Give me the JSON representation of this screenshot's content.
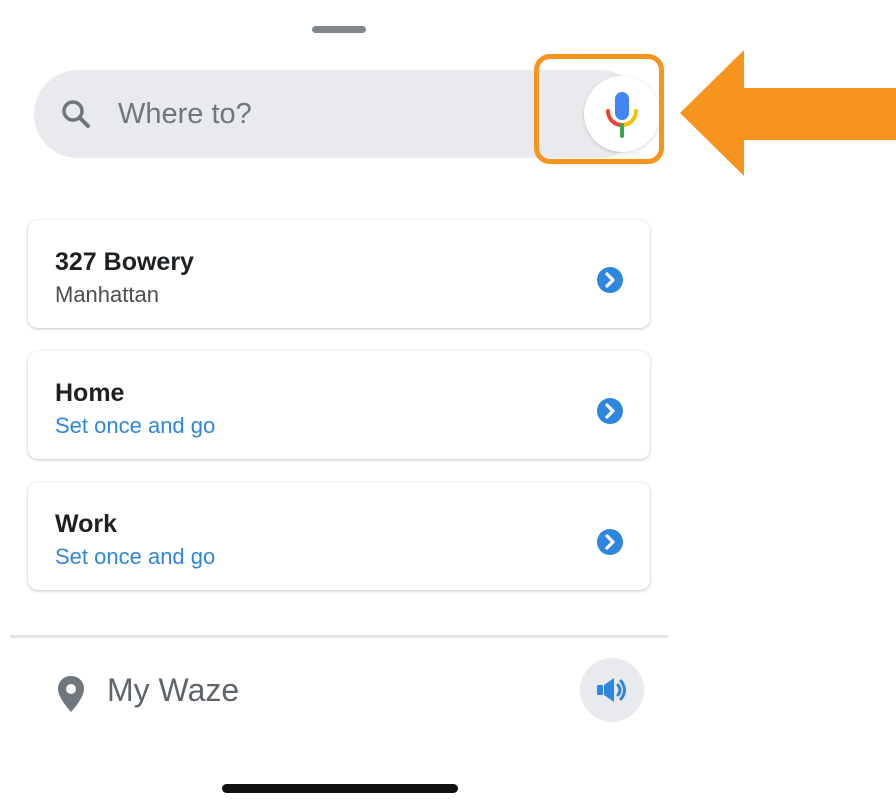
{
  "search": {
    "placeholder": "Where to?"
  },
  "destinations": [
    {
      "title": "327 Bowery",
      "subtitle": "Manhattan"
    },
    {
      "title": "Home",
      "subtitle": "Set once and go"
    },
    {
      "title": "Work",
      "subtitle": "Set once and go"
    }
  ],
  "footer": {
    "my_waze_label": "My Waze"
  },
  "icons": {
    "search": "search-icon",
    "mic": "microphone-icon",
    "chevron": "chevron-right-circle-icon",
    "pin": "location-pin-icon",
    "sound": "speaker-icon"
  },
  "colors": {
    "accent_blue": "#2e86de",
    "highlight_orange": "#f7941d",
    "search_bg": "#e8eaed"
  }
}
